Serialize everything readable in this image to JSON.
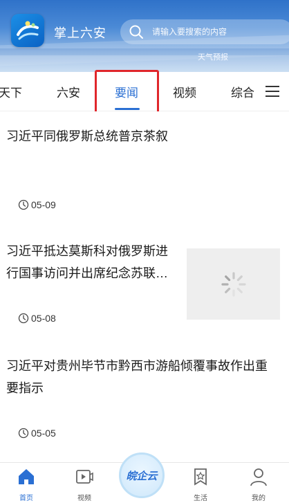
{
  "header": {
    "app_title": "掌上六安",
    "search_placeholder": "请输入要搜索的内容",
    "weather": "天气预报"
  },
  "tabs": [
    {
      "label": "天下"
    },
    {
      "label": "六安"
    },
    {
      "label": "要闻",
      "active": true
    },
    {
      "label": "视频"
    },
    {
      "label": "综合"
    }
  ],
  "news": [
    {
      "title_lines": [
        "习近平同俄罗斯总统普京茶叙"
      ],
      "date": "05-09",
      "has_thumbnail": false
    },
    {
      "title_lines": [
        "习近平抵达莫斯科对俄罗斯进",
        "行国事访问并出席纪念苏联…"
      ],
      "date": "05-08",
      "has_thumbnail": true
    },
    {
      "title_lines": [
        "习近平对贵州毕节市黔西市游船倾覆事故作出重",
        "要指示"
      ],
      "date": "05-05",
      "has_thumbnail": false
    }
  ],
  "bottom_nav": [
    {
      "label": "首页",
      "icon": "home-icon",
      "active": true
    },
    {
      "label": "视频",
      "icon": "video-icon"
    },
    {
      "label": "",
      "icon": "center-logo",
      "center_text": "皖企云"
    },
    {
      "label": "生活",
      "icon": "bookmark-star-icon"
    },
    {
      "label": "我的",
      "icon": "user-icon"
    }
  ],
  "colors": {
    "accent": "#2a6fd3",
    "highlight_box": "#e0262b",
    "header_top": "#2f72c9"
  }
}
